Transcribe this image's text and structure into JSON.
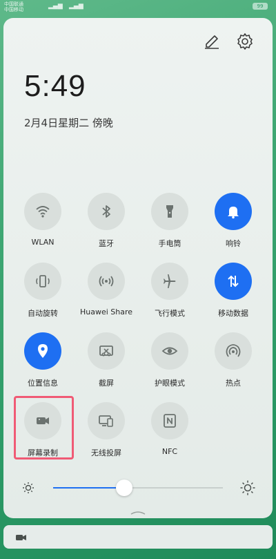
{
  "status_bar": {
    "carrier_1": "中国联通",
    "carrier_2": "中国移动",
    "battery": "99"
  },
  "panel": {
    "clock": {
      "time": "5:49",
      "date": "2月4日星期二 傍晚"
    },
    "tiles": [
      {
        "label": "WLAN",
        "icon": "wifi-icon",
        "active": false
      },
      {
        "label": "蓝牙",
        "icon": "bluetooth-icon",
        "active": false
      },
      {
        "label": "手电筒",
        "icon": "flashlight-icon",
        "active": false
      },
      {
        "label": "响铃",
        "icon": "bell-icon",
        "active": true
      },
      {
        "label": "自动旋转",
        "icon": "auto-rotate-icon",
        "active": false
      },
      {
        "label": "Huawei Share",
        "icon": "huawei-share-icon",
        "active": false
      },
      {
        "label": "飞行模式",
        "icon": "airplane-icon",
        "active": false
      },
      {
        "label": "移动数据",
        "icon": "mobile-data-icon",
        "active": true
      },
      {
        "label": "位置信息",
        "icon": "location-icon",
        "active": true
      },
      {
        "label": "截屏",
        "icon": "screenshot-icon",
        "active": false
      },
      {
        "label": "护眼模式",
        "icon": "eye-comfort-icon",
        "active": false
      },
      {
        "label": "热点",
        "icon": "hotspot-icon",
        "active": false
      },
      {
        "label": "屏幕录制",
        "icon": "screen-record-icon",
        "active": false
      },
      {
        "label": "无线投屏",
        "icon": "wireless-projection-icon",
        "active": false
      },
      {
        "label": "NFC",
        "icon": "nfc-icon",
        "active": false
      }
    ],
    "brightness_level": 0.42
  },
  "colors": {
    "accent": "#1e6ff2",
    "tile_off": "#d9dfdc",
    "highlight": "#f05a75",
    "background": "#2c9a66"
  }
}
